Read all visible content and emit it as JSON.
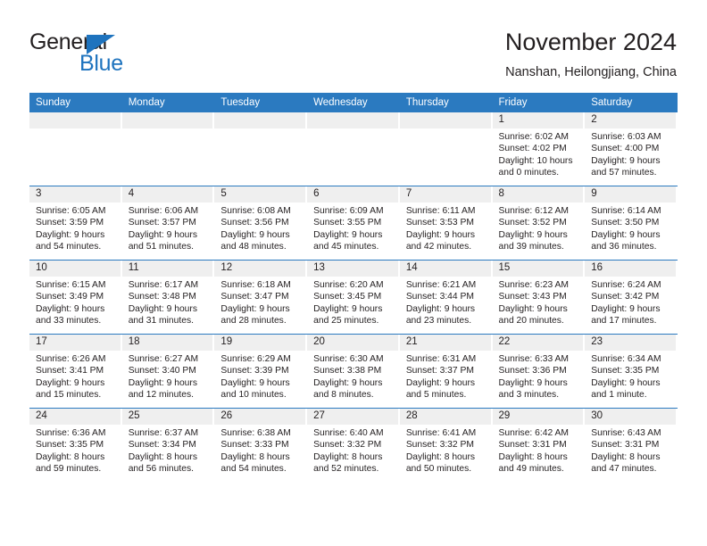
{
  "brand": {
    "name_part1": "General",
    "name_part2": "Blue",
    "accent_color": "#1e73be",
    "triangle_icon": "triangle-icon"
  },
  "header": {
    "title": "November 2024",
    "subtitle": "Nanshan, Heilongjiang, China"
  },
  "theme": {
    "header_blue": "#2b7ac0",
    "daynum_band": "#efefef",
    "text": "#231f20"
  },
  "weekdays": [
    "Sunday",
    "Monday",
    "Tuesday",
    "Wednesday",
    "Thursday",
    "Friday",
    "Saturday"
  ],
  "labels": {
    "sunrise_prefix": "Sunrise: ",
    "sunset_prefix": "Sunset: ",
    "daylight_prefix": "Daylight: "
  },
  "weeks": [
    [
      {
        "day": "",
        "empty": true
      },
      {
        "day": "",
        "empty": true
      },
      {
        "day": "",
        "empty": true
      },
      {
        "day": "",
        "empty": true
      },
      {
        "day": "",
        "empty": true
      },
      {
        "day": "1",
        "sunrise": "Sunrise: 6:02 AM",
        "sunset": "Sunset: 4:02 PM",
        "daylight1": "Daylight: 10 hours",
        "daylight2": "and 0 minutes."
      },
      {
        "day": "2",
        "sunrise": "Sunrise: 6:03 AM",
        "sunset": "Sunset: 4:00 PM",
        "daylight1": "Daylight: 9 hours",
        "daylight2": "and 57 minutes."
      }
    ],
    [
      {
        "day": "3",
        "sunrise": "Sunrise: 6:05 AM",
        "sunset": "Sunset: 3:59 PM",
        "daylight1": "Daylight: 9 hours",
        "daylight2": "and 54 minutes."
      },
      {
        "day": "4",
        "sunrise": "Sunrise: 6:06 AM",
        "sunset": "Sunset: 3:57 PM",
        "daylight1": "Daylight: 9 hours",
        "daylight2": "and 51 minutes."
      },
      {
        "day": "5",
        "sunrise": "Sunrise: 6:08 AM",
        "sunset": "Sunset: 3:56 PM",
        "daylight1": "Daylight: 9 hours",
        "daylight2": "and 48 minutes."
      },
      {
        "day": "6",
        "sunrise": "Sunrise: 6:09 AM",
        "sunset": "Sunset: 3:55 PM",
        "daylight1": "Daylight: 9 hours",
        "daylight2": "and 45 minutes."
      },
      {
        "day": "7",
        "sunrise": "Sunrise: 6:11 AM",
        "sunset": "Sunset: 3:53 PM",
        "daylight1": "Daylight: 9 hours",
        "daylight2": "and 42 minutes."
      },
      {
        "day": "8",
        "sunrise": "Sunrise: 6:12 AM",
        "sunset": "Sunset: 3:52 PM",
        "daylight1": "Daylight: 9 hours",
        "daylight2": "and 39 minutes."
      },
      {
        "day": "9",
        "sunrise": "Sunrise: 6:14 AM",
        "sunset": "Sunset: 3:50 PM",
        "daylight1": "Daylight: 9 hours",
        "daylight2": "and 36 minutes."
      }
    ],
    [
      {
        "day": "10",
        "sunrise": "Sunrise: 6:15 AM",
        "sunset": "Sunset: 3:49 PM",
        "daylight1": "Daylight: 9 hours",
        "daylight2": "and 33 minutes."
      },
      {
        "day": "11",
        "sunrise": "Sunrise: 6:17 AM",
        "sunset": "Sunset: 3:48 PM",
        "daylight1": "Daylight: 9 hours",
        "daylight2": "and 31 minutes."
      },
      {
        "day": "12",
        "sunrise": "Sunrise: 6:18 AM",
        "sunset": "Sunset: 3:47 PM",
        "daylight1": "Daylight: 9 hours",
        "daylight2": "and 28 minutes."
      },
      {
        "day": "13",
        "sunrise": "Sunrise: 6:20 AM",
        "sunset": "Sunset: 3:45 PM",
        "daylight1": "Daylight: 9 hours",
        "daylight2": "and 25 minutes."
      },
      {
        "day": "14",
        "sunrise": "Sunrise: 6:21 AM",
        "sunset": "Sunset: 3:44 PM",
        "daylight1": "Daylight: 9 hours",
        "daylight2": "and 23 minutes."
      },
      {
        "day": "15",
        "sunrise": "Sunrise: 6:23 AM",
        "sunset": "Sunset: 3:43 PM",
        "daylight1": "Daylight: 9 hours",
        "daylight2": "and 20 minutes."
      },
      {
        "day": "16",
        "sunrise": "Sunrise: 6:24 AM",
        "sunset": "Sunset: 3:42 PM",
        "daylight1": "Daylight: 9 hours",
        "daylight2": "and 17 minutes."
      }
    ],
    [
      {
        "day": "17",
        "sunrise": "Sunrise: 6:26 AM",
        "sunset": "Sunset: 3:41 PM",
        "daylight1": "Daylight: 9 hours",
        "daylight2": "and 15 minutes."
      },
      {
        "day": "18",
        "sunrise": "Sunrise: 6:27 AM",
        "sunset": "Sunset: 3:40 PM",
        "daylight1": "Daylight: 9 hours",
        "daylight2": "and 12 minutes."
      },
      {
        "day": "19",
        "sunrise": "Sunrise: 6:29 AM",
        "sunset": "Sunset: 3:39 PM",
        "daylight1": "Daylight: 9 hours",
        "daylight2": "and 10 minutes."
      },
      {
        "day": "20",
        "sunrise": "Sunrise: 6:30 AM",
        "sunset": "Sunset: 3:38 PM",
        "daylight1": "Daylight: 9 hours",
        "daylight2": "and 8 minutes."
      },
      {
        "day": "21",
        "sunrise": "Sunrise: 6:31 AM",
        "sunset": "Sunset: 3:37 PM",
        "daylight1": "Daylight: 9 hours",
        "daylight2": "and 5 minutes."
      },
      {
        "day": "22",
        "sunrise": "Sunrise: 6:33 AM",
        "sunset": "Sunset: 3:36 PM",
        "daylight1": "Daylight: 9 hours",
        "daylight2": "and 3 minutes."
      },
      {
        "day": "23",
        "sunrise": "Sunrise: 6:34 AM",
        "sunset": "Sunset: 3:35 PM",
        "daylight1": "Daylight: 9 hours",
        "daylight2": "and 1 minute."
      }
    ],
    [
      {
        "day": "24",
        "sunrise": "Sunrise: 6:36 AM",
        "sunset": "Sunset: 3:35 PM",
        "daylight1": "Daylight: 8 hours",
        "daylight2": "and 59 minutes."
      },
      {
        "day": "25",
        "sunrise": "Sunrise: 6:37 AM",
        "sunset": "Sunset: 3:34 PM",
        "daylight1": "Daylight: 8 hours",
        "daylight2": "and 56 minutes."
      },
      {
        "day": "26",
        "sunrise": "Sunrise: 6:38 AM",
        "sunset": "Sunset: 3:33 PM",
        "daylight1": "Daylight: 8 hours",
        "daylight2": "and 54 minutes."
      },
      {
        "day": "27",
        "sunrise": "Sunrise: 6:40 AM",
        "sunset": "Sunset: 3:32 PM",
        "daylight1": "Daylight: 8 hours",
        "daylight2": "and 52 minutes."
      },
      {
        "day": "28",
        "sunrise": "Sunrise: 6:41 AM",
        "sunset": "Sunset: 3:32 PM",
        "daylight1": "Daylight: 8 hours",
        "daylight2": "and 50 minutes."
      },
      {
        "day": "29",
        "sunrise": "Sunrise: 6:42 AM",
        "sunset": "Sunset: 3:31 PM",
        "daylight1": "Daylight: 8 hours",
        "daylight2": "and 49 minutes."
      },
      {
        "day": "30",
        "sunrise": "Sunrise: 6:43 AM",
        "sunset": "Sunset: 3:31 PM",
        "daylight1": "Daylight: 8 hours",
        "daylight2": "and 47 minutes."
      }
    ]
  ]
}
